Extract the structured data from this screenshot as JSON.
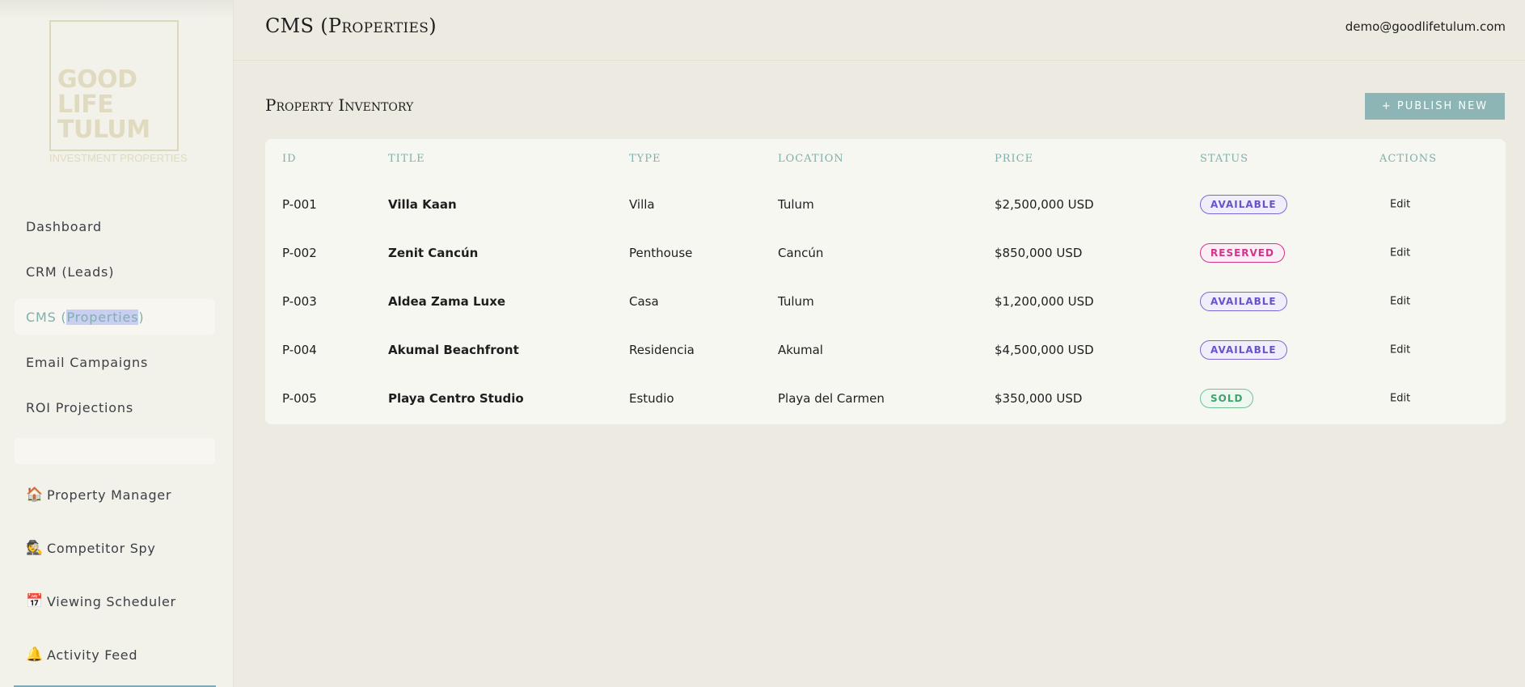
{
  "sidebar": {
    "logo": {
      "line1": "GOOD",
      "line2": "LIFE",
      "line3": "TULUM",
      "subtitle": "INVESTMENT PROPERTIES"
    },
    "nav": [
      {
        "label": "Dashboard"
      },
      {
        "label": "CRM (Leads)"
      },
      {
        "label_pre": "CMS (",
        "label_sel": "Properties",
        "label_post": ")",
        "active": true
      },
      {
        "label": "Email Campaigns"
      },
      {
        "label": "ROI Projections"
      }
    ],
    "tools": [
      {
        "icon": "house-icon",
        "glyph": "🏠",
        "label": "Property Manager"
      },
      {
        "icon": "spy-icon",
        "glyph": "🕵",
        "label": "Competitor Spy"
      },
      {
        "icon": "calendar-icon",
        "glyph": "📅",
        "label": "Viewing Scheduler"
      },
      {
        "icon": "bell-icon",
        "glyph": "🔔",
        "label": "Activity Feed"
      }
    ]
  },
  "header": {
    "title": "CMS (Properties)",
    "user_email": "demo@goodlifetulum.com"
  },
  "main": {
    "section_title": "Property Inventory",
    "publish_label": "+ PUBLISH NEW",
    "table": {
      "columns": [
        "ID",
        "TITLE",
        "TYPE",
        "LOCATION",
        "PRICE",
        "STATUS",
        "ACTIONS"
      ],
      "rows": [
        {
          "id": "P-001",
          "title": "Villa Kaan",
          "type": "Villa",
          "location": "Tulum",
          "price": "$2,500,000 USD",
          "status": "AVAILABLE",
          "action": "Edit"
        },
        {
          "id": "P-002",
          "title": "Zenit Cancún",
          "type": "Penthouse",
          "location": "Cancún",
          "price": "$850,000 USD",
          "status": "RESERVED",
          "action": "Edit"
        },
        {
          "id": "P-003",
          "title": "Aldea Zama Luxe",
          "type": "Casa",
          "location": "Tulum",
          "price": "$1,200,000 USD",
          "status": "AVAILABLE",
          "action": "Edit"
        },
        {
          "id": "P-004",
          "title": "Akumal Beachfront",
          "type": "Residencia",
          "location": "Akumal",
          "price": "$4,500,000 USD",
          "status": "AVAILABLE",
          "action": "Edit"
        },
        {
          "id": "P-005",
          "title": "Playa Centro Studio",
          "type": "Estudio",
          "location": "Playa del Carmen",
          "price": "$350,000 USD",
          "status": "SOLD",
          "action": "Edit"
        }
      ]
    }
  },
  "colors": {
    "accent": "#8db5b5",
    "available": "#6a52c8",
    "reserved": "#d0348b",
    "sold": "#3aa56b"
  }
}
